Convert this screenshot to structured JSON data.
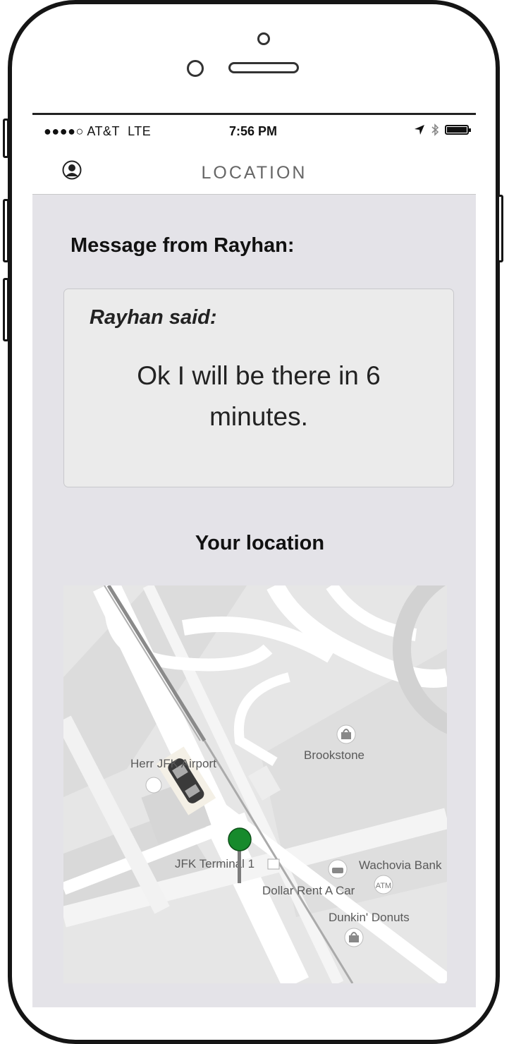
{
  "status_bar": {
    "carrier": "●●●●○ AT&T",
    "network": "LTE",
    "time": "7:56 PM"
  },
  "header": {
    "title": "LOCATION",
    "profile_icon": "person-circle-icon"
  },
  "message": {
    "heading": "Message from Rayhan:",
    "sender_line": "Rayhan said:",
    "text": "Ok I will be there in 6 minutes."
  },
  "location": {
    "heading": "Your location"
  },
  "map": {
    "labels": {
      "airport": "Herr  JFK Airport",
      "brookstone": "Brookstone",
      "terminal": "JFK Terminal 1",
      "wachovia": "Wachovia Bank",
      "dollar": "Dollar Rent A Car",
      "dunkin": "Dunkin' Donuts",
      "atm": "ATM"
    },
    "pin_color": "#178a2c",
    "icons": [
      "taxi-icon",
      "shopping-bag-icon",
      "car-rental-icon",
      "atm-icon",
      "location-pin-icon"
    ]
  }
}
